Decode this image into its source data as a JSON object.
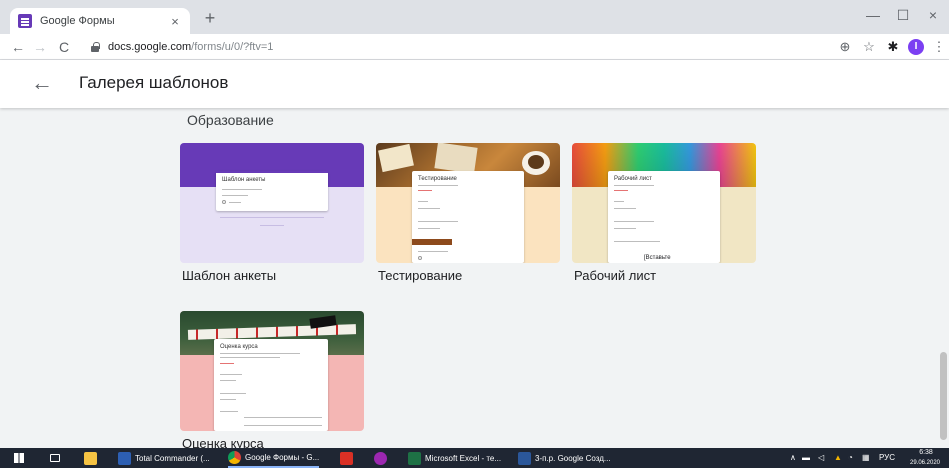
{
  "browser": {
    "tab_title": "Google Формы",
    "tab_close": "×",
    "new_tab": "+",
    "window_controls": {
      "minimize": "—",
      "maximize": "☐",
      "close": "×"
    },
    "nav": {
      "back": "←",
      "forward": "→",
      "reload": "C"
    },
    "url_host": "docs.google.com",
    "url_path": "/forms/u/0/?ftv=1",
    "toolbar_icons": {
      "zoom": "⊕",
      "star": "☆",
      "extensions": "✱"
    },
    "profile_initial": "I"
  },
  "header": {
    "back_icon": "←",
    "title": "Галерея шаблонов"
  },
  "section": {
    "title": "Образование"
  },
  "templates": [
    {
      "name": "Шаблон анкеты",
      "form_title": "Шаблон анкеты"
    },
    {
      "name": "Тестирование",
      "form_title": "Тестирование"
    },
    {
      "name": "Рабочий лист",
      "form_title": "Рабочий лист",
      "overlay_text": "[Вставьте"
    },
    {
      "name": "Оценка курса",
      "form_title": "Оценка курса"
    }
  ],
  "taskbar": {
    "items": [
      {
        "label": "Total Commander (...",
        "color": "#2d5fb3"
      },
      {
        "label": "Google Формы - G...",
        "color": "#e8a33d"
      },
      {
        "label": "",
        "color": "#d93025"
      },
      {
        "label": "",
        "color": "#9c27b0"
      },
      {
        "label": "Microsoft Excel - те...",
        "color": "#1e7145"
      },
      {
        "label": "3-п.р. Google Созд...",
        "color": "#2b579a"
      }
    ],
    "tray": {
      "lang": "РУС",
      "time": "6:38",
      "date": "29.06.2020"
    }
  },
  "colors": {
    "purple_header": "#673ab7",
    "purple_light": "#e6e0f5",
    "peach": "#fbe3bf",
    "pale_yellow": "#f1e6c4",
    "pink": "#f4b6b4"
  }
}
